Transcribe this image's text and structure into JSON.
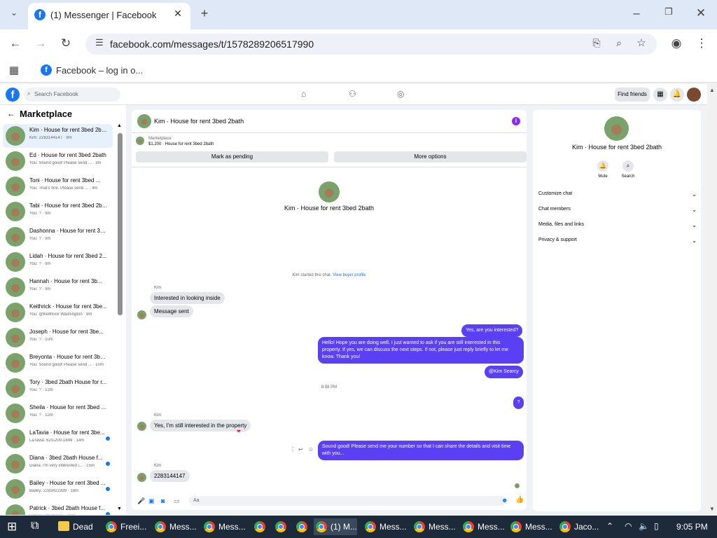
{
  "browser": {
    "tab_title": "(1) Messenger | Facebook",
    "url": "facebook.com/messages/t/1578289206517990",
    "bookmark": "Facebook – log in o..."
  },
  "fb_header": {
    "search_placeholder": "Search Facebook",
    "find_friends": "Find friends"
  },
  "left": {
    "title": "Marketplace",
    "conversations": [
      {
        "name": "Kim · House for rent 3bed 2ba...",
        "sub": "Kim: 2283144147 · 9m",
        "unread": false
      },
      {
        "name": "Ed · House for rent 3bed 2bath",
        "sub": "You: Sound good! Please send ... · 3m",
        "unread": false
      },
      {
        "name": "Toni · House for rent 3bed ...",
        "sub": "You: That's fine. Please send ... · 4m",
        "unread": false
      },
      {
        "name": "Tabi · House for rent 3bed 2ba...",
        "sub": "You: ? · 9m",
        "unread": false
      },
      {
        "name": "Dashonna · House for rent 3b...",
        "sub": "You: ? · 9m",
        "unread": false
      },
      {
        "name": "Lidah · House for rent 3bed 2...",
        "sub": "You: ? · 9m",
        "unread": false
      },
      {
        "name": "Hannah · House for rent 3b...",
        "sub": "You: ? · 9m",
        "unread": false
      },
      {
        "name": "Keithrick · House for rent 3be...",
        "sub": "You: @Keithrick Washington · 9m",
        "unread": false
      },
      {
        "name": "Joseph · House for rent 3be...",
        "sub": "You: ? · 10m",
        "unread": false
      },
      {
        "name": "Breyonta · House for rent 3be...",
        "sub": "You: Sound good! Please send ... · 10m",
        "unread": false
      },
      {
        "name": "Tory · 3bed 2bath House for r...",
        "sub": "You: ? · 12m",
        "unread": false
      },
      {
        "name": "Sheila · House for rent 3bed 2...",
        "sub": "You: ? · 12m",
        "unread": false
      },
      {
        "name": "LaTavia · House for rent 3be...",
        "sub": "LaTavia: 620-200-1849 · 14m",
        "unread": true
      },
      {
        "name": "Diana · 3bed 2bath House f...",
        "sub": "Diana: I'm very interested i... · 15m",
        "unread": true
      },
      {
        "name": "Bailey · House for rent 3bed ...",
        "sub": "Bailey: 2283422399 · 18m",
        "unread": true
      },
      {
        "name": "Patrick · 3bed 2bath House f...",
        "sub": "Patrick: Stephanie · 20m",
        "unread": true
      }
    ]
  },
  "chat": {
    "header_name": "Kim · House for rent 3bed 2bath",
    "marketplace_label": "Marketplace",
    "listing": "$1,200 · House for rent 3bed 2bath",
    "btn_pending": "Mark as pending",
    "btn_more": "More options",
    "profile_name": "Kim · House for rent 3bed 2bath",
    "started_text": "Kim started this chat.",
    "started_link": "View buyer profile",
    "sender": "Kim",
    "msg_in_1": "Interested in looking inside",
    "msg_in_2": "Message sent",
    "msg_out_1": "Yes, are you interested?",
    "msg_out_2": "Hello! Hope you are doing well. I just wanted to ask if you are still interested in this property. If yes, we can discuss the next steps. If not, please just reply briefly to let me know. Thank you!",
    "msg_out_3": "@Kim Searcy",
    "time": "8:58 PM",
    "msg_out_4": "?",
    "msg_in_3": "Yes, I'm still interested in the property",
    "msg_out_5": "Sound good! Please send me your number so that I can share the details and visit time with you...",
    "msg_in_4": "2283144147",
    "composer_placeholder": "Aa"
  },
  "right": {
    "name": "Kim · House for rent 3bed 2bath",
    "mute": "Mute",
    "search": "Search",
    "rows": [
      "Customize chat",
      "Chat members",
      "Media, files and links",
      "Privacy & support"
    ]
  },
  "taskbar": {
    "items": [
      "Dead",
      "Freei...",
      "Mess...",
      "Mess...",
      "(1) M...",
      "Mess...",
      "Mess...",
      "Mess...",
      "Mess...",
      "Jaco..."
    ],
    "clock": "9:05 PM"
  },
  "colors": {
    "accent": "#1877f2",
    "outgoing": "#5b3ff5"
  }
}
